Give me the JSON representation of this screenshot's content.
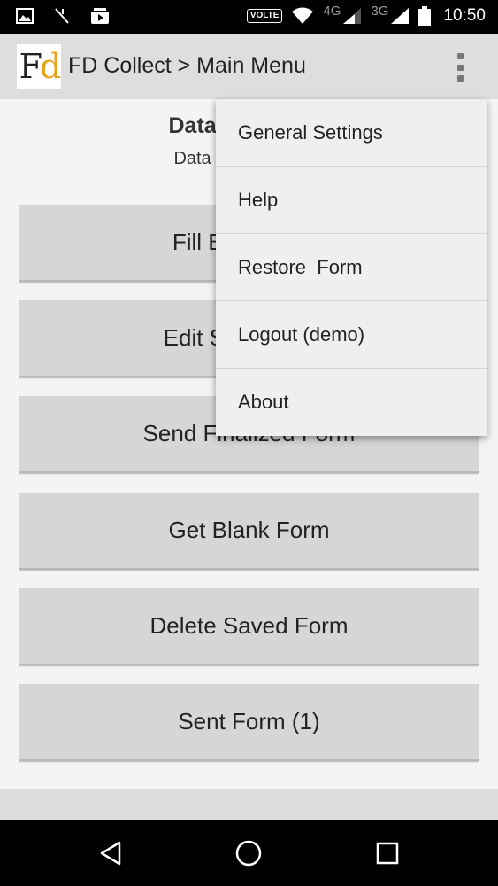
{
  "status_bar": {
    "volte": "VOLTE",
    "network_1": "4G",
    "network_2": "3G",
    "time": "10:50"
  },
  "action_bar": {
    "title": "FD Collect > Main Menu",
    "logo_f": "F",
    "logo_d": "d"
  },
  "main": {
    "heading": "Data Collection",
    "subheading": "Data collection app",
    "buttons": [
      {
        "label": "Fill Blank Form"
      },
      {
        "label": "Edit Saved Form"
      },
      {
        "label": "Send Finalized Form"
      },
      {
        "label": "Get Blank Form"
      },
      {
        "label": "Delete Saved Form"
      },
      {
        "label": "Sent Form (1)"
      }
    ]
  },
  "overflow_menu": {
    "items": [
      {
        "label": "General Settings"
      },
      {
        "label": "Help"
      },
      {
        "label": "Restore  Form"
      },
      {
        "label": "Logout (demo)"
      },
      {
        "label": "About"
      }
    ]
  },
  "colors": {
    "action_bar_bg": "#dedede",
    "button_bg": "#d6d6d6",
    "logo_accent": "#e8a21a",
    "menu_bg": "#efefef"
  },
  "icons": [
    "gallery-icon",
    "signal-off-icon",
    "media-icon",
    "wifi-icon",
    "signal-4g-icon",
    "signal-3g-icon",
    "battery-icon",
    "overflow-menu-icon",
    "back-icon",
    "home-icon",
    "recents-icon"
  ]
}
